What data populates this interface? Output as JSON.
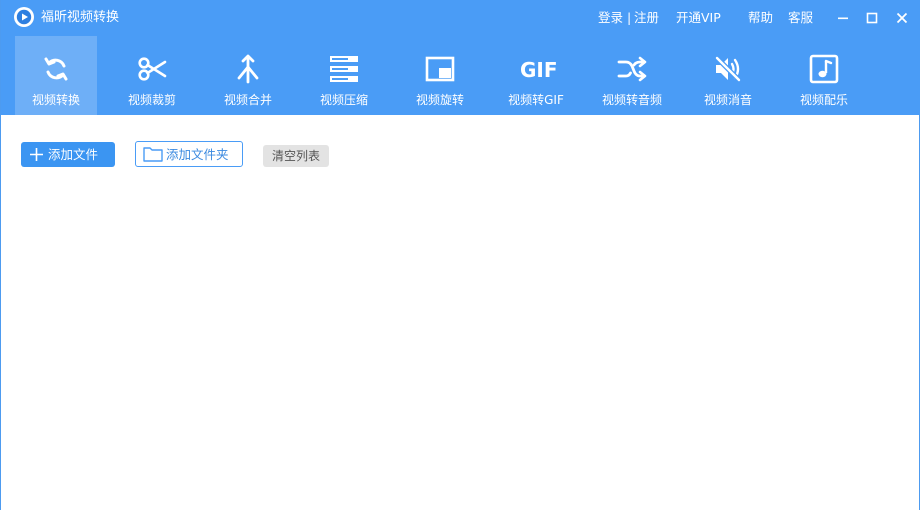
{
  "app": {
    "title": "福昕视频转换"
  },
  "topbar": {
    "login": "登录",
    "separator": "|",
    "register": "注册",
    "vip": "开通VIP",
    "help": "帮助",
    "service": "客服"
  },
  "toolbar": {
    "items": [
      {
        "label": "视频转换",
        "icon": "refresh-icon",
        "active": true
      },
      {
        "label": "视频裁剪",
        "icon": "scissors-icon",
        "active": false
      },
      {
        "label": "视频合并",
        "icon": "merge-icon",
        "active": false
      },
      {
        "label": "视频压缩",
        "icon": "compress-icon",
        "active": false
      },
      {
        "label": "视频旋转",
        "icon": "rotate-icon",
        "active": false
      },
      {
        "label": "视频转GIF",
        "icon": "gif-icon",
        "active": false,
        "icon_text": "GIF"
      },
      {
        "label": "视频转音频",
        "icon": "shuffle-icon",
        "active": false
      },
      {
        "label": "视频消音",
        "icon": "mute-icon",
        "active": false
      },
      {
        "label": "视频配乐",
        "icon": "music-icon",
        "active": false
      }
    ]
  },
  "actions": {
    "add_file": "添加文件",
    "add_folder": "添加文件夹",
    "clear_list": "清空列表"
  },
  "colors": {
    "header": "#4a9cf6",
    "primary_button": "#3b95f2",
    "clear_button": "#e3e3e3"
  }
}
